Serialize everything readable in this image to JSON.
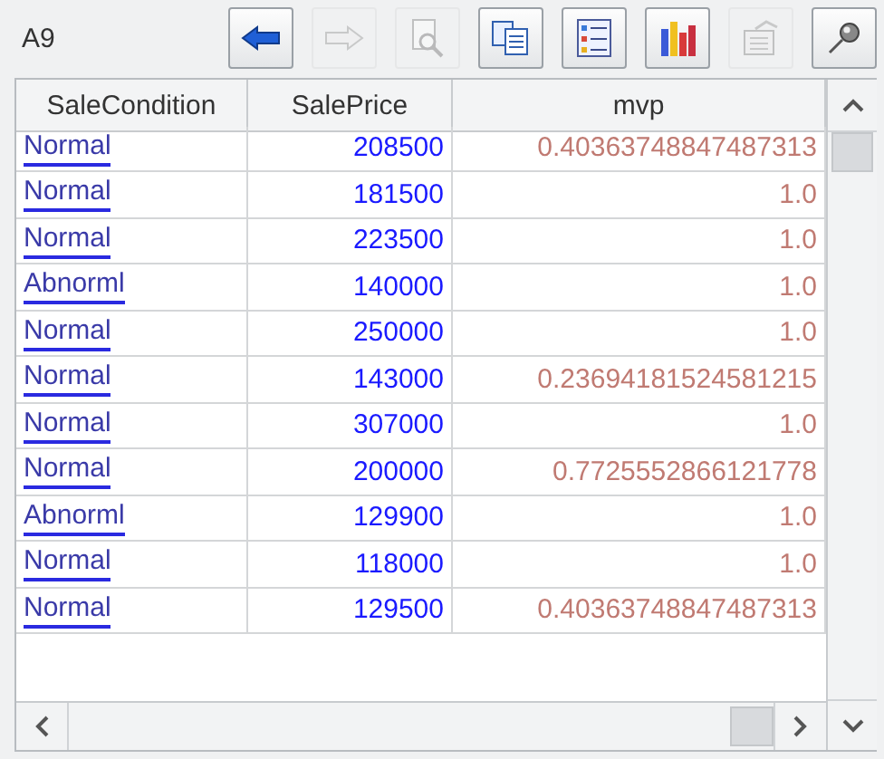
{
  "cell_name": "A9",
  "toolbar": [
    {
      "kind": "back",
      "disabled": false
    },
    {
      "kind": "forward",
      "disabled": true
    },
    {
      "kind": "preview",
      "disabled": true
    },
    {
      "kind": "copy",
      "disabled": false
    },
    {
      "kind": "list",
      "disabled": false
    },
    {
      "kind": "chart",
      "disabled": false
    },
    {
      "kind": "properties",
      "disabled": true
    },
    {
      "kind": "pin",
      "disabled": false
    }
  ],
  "table": {
    "columns": [
      "SaleCondition",
      "SalePrice",
      "mvp"
    ],
    "rows": [
      [
        "Normal",
        "208500",
        "0.40363748847487313"
      ],
      [
        "Normal",
        "181500",
        "1.0"
      ],
      [
        "Normal",
        "223500",
        "1.0"
      ],
      [
        "Abnorml",
        "140000",
        "1.0"
      ],
      [
        "Normal",
        "250000",
        "1.0"
      ],
      [
        "Normal",
        "143000",
        "0.23694181524581215"
      ],
      [
        "Normal",
        "307000",
        "1.0"
      ],
      [
        "Normal",
        "200000",
        "0.7725552866121778"
      ],
      [
        "Abnorml",
        "129900",
        "1.0"
      ],
      [
        "Normal",
        "118000",
        "1.0"
      ],
      [
        "Normal",
        "129500",
        "0.40363748847487313"
      ]
    ]
  }
}
